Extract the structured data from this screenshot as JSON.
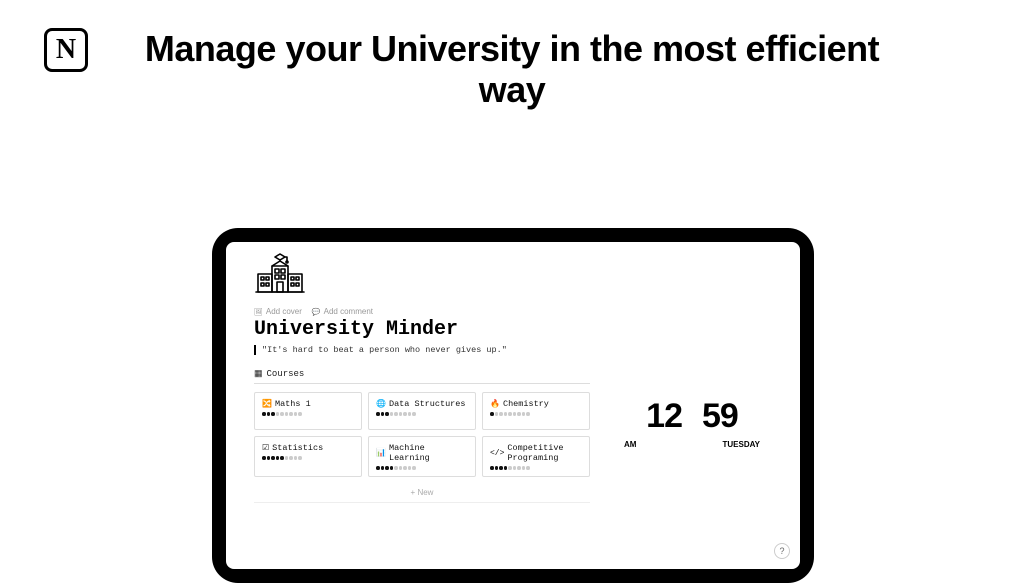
{
  "logo": "N",
  "headline": "Manage your University in the most efficient way",
  "actions": {
    "add_cover": "Add cover",
    "add_comment": "Add comment"
  },
  "page_title": "University Minder",
  "quote": "\"It's hard to beat a person who never gives up.\"",
  "courses_label": "Courses",
  "courses": [
    {
      "icon": "🔀",
      "name": "Maths 1",
      "filled": 3
    },
    {
      "icon": "🌐",
      "name": "Data Structures",
      "filled": 3
    },
    {
      "icon": "🔥",
      "name": "Chemistry",
      "filled": 1
    },
    {
      "icon": "☑",
      "name": "Statistics",
      "filled": 5
    },
    {
      "icon": "📊",
      "name": "Machine Learning",
      "filled": 4
    },
    {
      "icon": "</>",
      "name": "Competitive Programing",
      "filled": 4
    }
  ],
  "new_label": "+ New",
  "clock": {
    "hour": "12",
    "minute": "59",
    "ampm": "AM",
    "day": "TUESDAY"
  },
  "help": "?"
}
